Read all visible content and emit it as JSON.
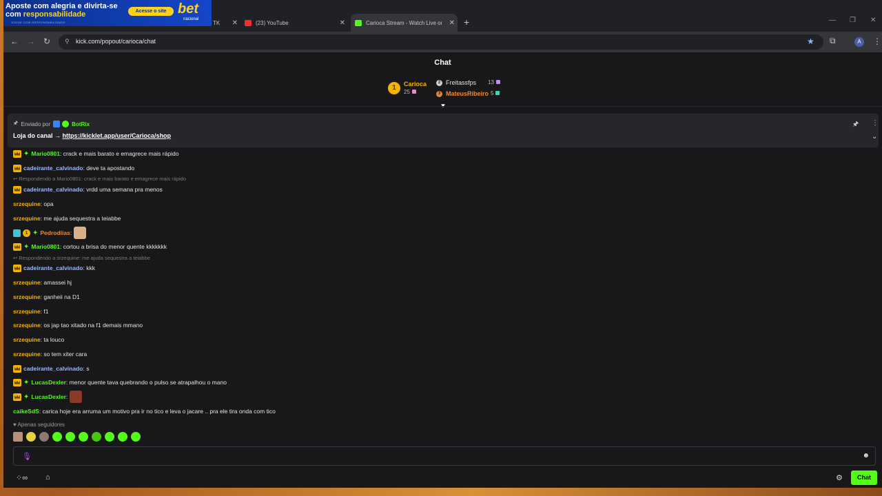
{
  "ad": {
    "line1": "Aposte com alegria e divirta-se",
    "line2_prefix": "com ",
    "line2_highlight": "responsabilidade",
    "cta": "Acesse o site",
    "logo": "bet",
    "logo_sub": "nacional",
    "fine_print": "JOGUE COM RESPONSABILIDADE"
  },
  "tabs": [
    {
      "label": "TK",
      "active": false
    },
    {
      "label": "(23) YouTube",
      "active": false
    },
    {
      "label": "Carioca Stream - Watch Live on",
      "active": true
    }
  ],
  "window_controls": {
    "minimize": "—",
    "restore": "❐",
    "close": "✕"
  },
  "address": {
    "url": "kick.com/popout/carioca/chat"
  },
  "profile_initial": "A",
  "chat": {
    "title": "Chat",
    "leaderboard": {
      "first": {
        "rank": "1",
        "name": "Carioca",
        "count": "25"
      },
      "second": {
        "name": "Freitassfps",
        "count": "13"
      },
      "third": {
        "name": "MateusRibeiro",
        "count": "5"
      }
    },
    "pinned": {
      "sent_by": "Enviado por",
      "bot": "BotRix",
      "message_prefix": "Loja do canal → ",
      "link": "https://kicklet.app/user/Carioca/shop"
    },
    "messages": [
      {
        "user": "Mario0801",
        "color": "#53fc18",
        "badges": [
          "crown",
          "star"
        ],
        "text": ": crack e mais barato e emagrece mais rápido"
      },
      {
        "user": "cadeirante_calvinado",
        "color": "#9bb8ff",
        "badges": [
          "crown"
        ],
        "text": ": deve ta apostando"
      },
      {
        "reply": "Respondendo a Mario0801: crack e mais barato e emagrece mais rápido"
      },
      {
        "user": "cadeirante_calvinado",
        "color": "#9bb8ff",
        "badges": [
          "crown"
        ],
        "text": ": vrdd uma semana pra menos"
      },
      {
        "user": "srzequine",
        "color": "#f5b400",
        "badges": [],
        "text": ": opa"
      },
      {
        "user": "srzequine",
        "color": "#f5b400",
        "badges": [],
        "text": ": me ajuda sequestra a teiabbe"
      },
      {
        "user": "Pedrodiias",
        "color": "#f08a2c",
        "badges": [
          "gift",
          "num",
          "star"
        ],
        "text": ":",
        "emote": true
      },
      {
        "user": "Mario0801",
        "color": "#53fc18",
        "badges": [
          "crown",
          "star"
        ],
        "text": ": cortou a brisa do menor quente kkkkkkk"
      },
      {
        "reply": "Respondendo a srzequine: me ajuda sequestra a teiabbe"
      },
      {
        "user": "cadeirante_calvinado",
        "color": "#9bb8ff",
        "badges": [
          "crown"
        ],
        "text": ": kkk"
      },
      {
        "user": "srzequine",
        "color": "#f5b400",
        "badges": [],
        "text": ": amassei hj"
      },
      {
        "user": "srzequine",
        "color": "#f5b400",
        "badges": [],
        "text": ": ganheii na D1"
      },
      {
        "user": "srzequine",
        "color": "#f5b400",
        "badges": [],
        "text": ": f1"
      },
      {
        "user": "srzequine",
        "color": "#f5b400",
        "badges": [],
        "text": ": os jap tao xitado na f1 demais mmano"
      },
      {
        "user": "srzequine",
        "color": "#f5b400",
        "badges": [],
        "text": ": ta louco"
      },
      {
        "user": "srzequine",
        "color": "#f5b400",
        "badges": [],
        "text": ": so tem xiter cara"
      },
      {
        "user": "cadeirante_calvinado",
        "color": "#9bb8ff",
        "badges": [
          "crown"
        ],
        "text": ": s"
      },
      {
        "user": "LucasDexler",
        "color": "#53fc18",
        "badges": [
          "crown",
          "star"
        ],
        "text": ": menor quente tava quebrando o pulso se atrapalhou o mano"
      },
      {
        "user": "LucasDexler",
        "color": "#53fc18",
        "badges": [
          "crown",
          "star"
        ],
        "text": ":",
        "emote": true
      },
      {
        "user": "caikeSdS",
        "color": "#53fc18",
        "badges": [],
        "text": ": carica hoje era arruma um motivo pra ir no tico e leva o jacare .. pra ele tira onda com tico"
      }
    ],
    "followers_only": "Apenas seguidores",
    "send_button": "Chat"
  },
  "colors": {
    "accent": "#53fc18",
    "background": "#18181b",
    "gold": "#f5b400"
  }
}
